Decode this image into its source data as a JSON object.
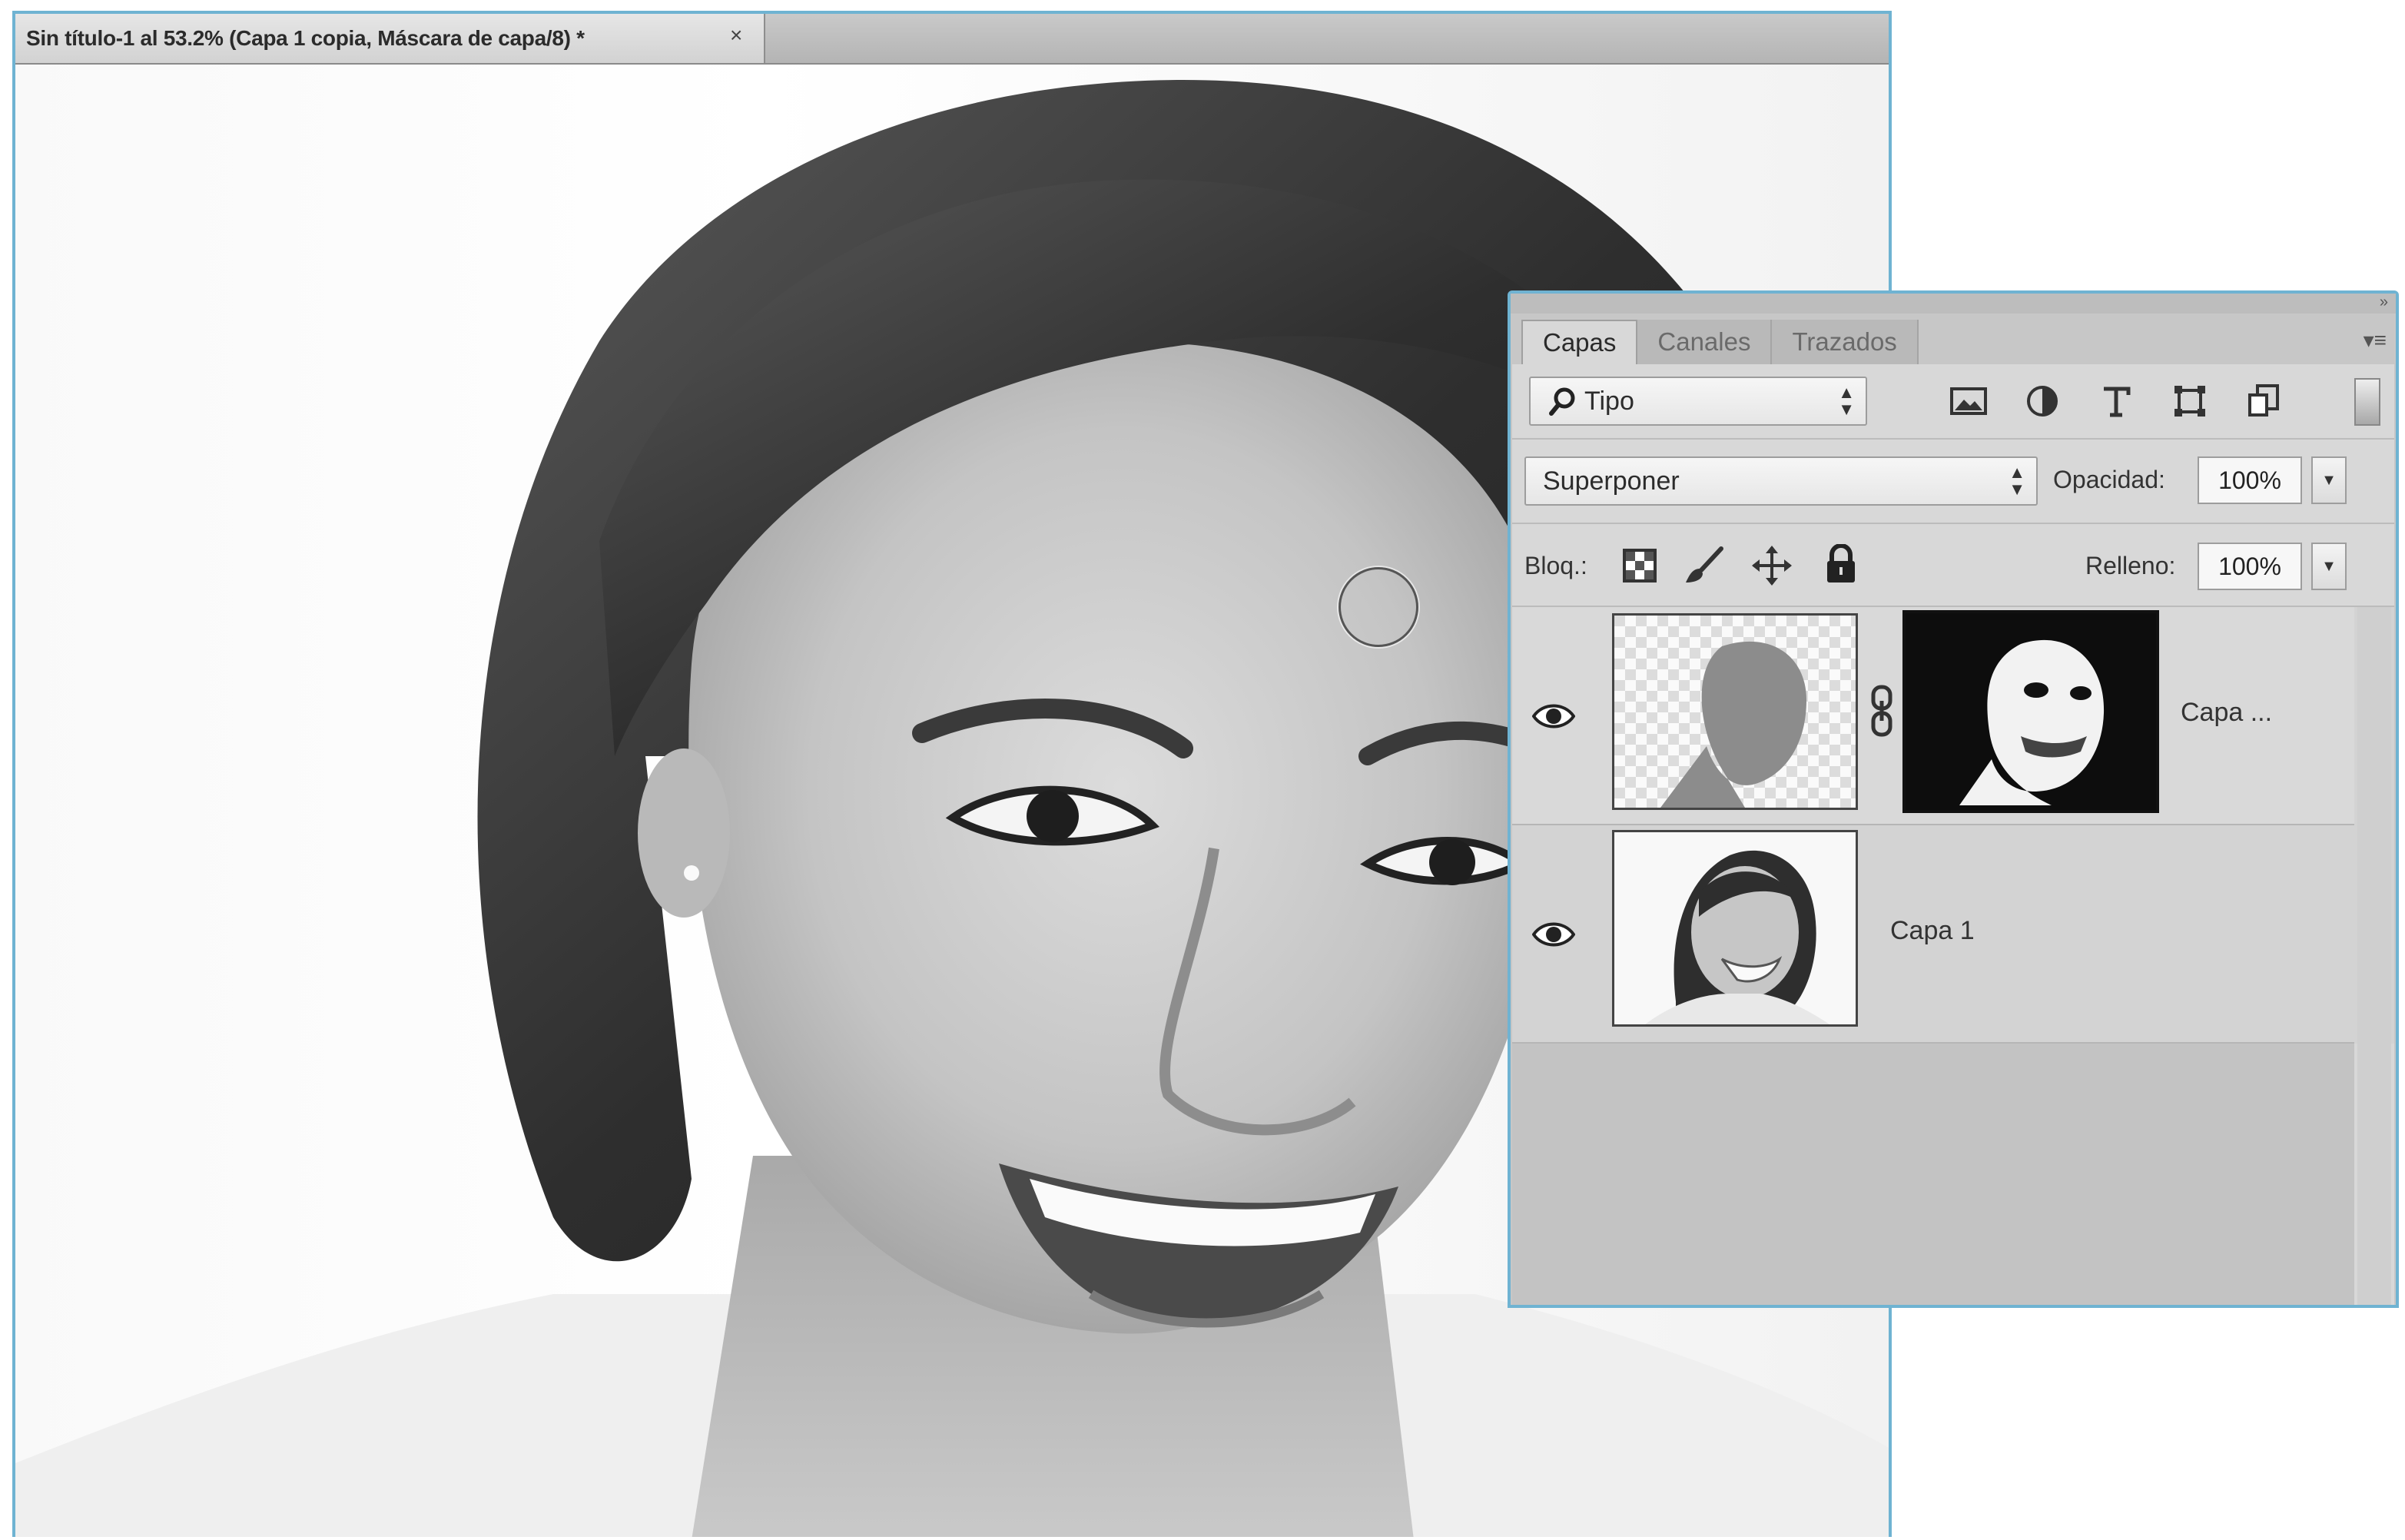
{
  "document": {
    "tab_title": "Sin título-1 al 53.2% (Capa 1 copia, Máscara de capa/8) *",
    "close_glyph": "×"
  },
  "panel": {
    "collapse_glyph": "»",
    "menu_glyph": "▾≡",
    "tabs": [
      {
        "label": "Capas",
        "active": true
      },
      {
        "label": "Canales",
        "active": false
      },
      {
        "label": "Trazados",
        "active": false
      }
    ],
    "filter": {
      "kind_value": "Tipo",
      "icons": [
        "image-filter-icon",
        "adjustment-filter-icon",
        "type-filter-icon",
        "shape-filter-icon",
        "smart-object-filter-icon"
      ]
    },
    "blend_mode": "Superponer",
    "opacity_label": "Opacidad:",
    "opacity_value": "100%",
    "lock_label": "Bloq.:",
    "fill_label": "Relleno:",
    "fill_value": "100%",
    "layers": [
      {
        "name": "Capa ...",
        "visible": true,
        "has_mask": true,
        "selected": true
      },
      {
        "name": "Capa 1",
        "visible": true,
        "has_mask": false,
        "selected": false
      }
    ]
  },
  "colors": {
    "window_accent": "#6fb3d2",
    "panel_bg": "#d8d8d8"
  }
}
